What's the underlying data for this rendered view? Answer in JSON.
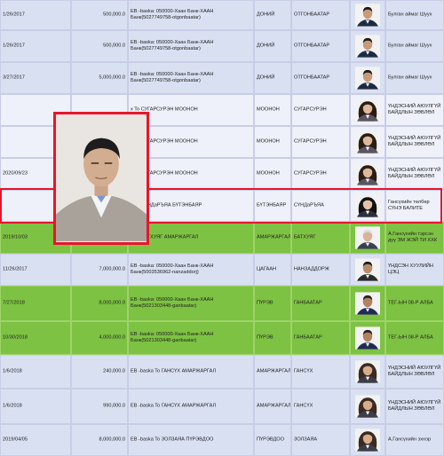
{
  "rows": [
    {
      "date": "1/26/2017",
      "amount": "500,000.0",
      "desc": "EB -baska: 050000-Хаан Банк-ХААН Банк(5027749758-otgonbaatar)",
      "surname": "ДОНИЙ",
      "name": "ОТГОНБААТАР",
      "position": "Булган аймаг Шуух",
      "style": "blue",
      "photo": "man"
    },
    {
      "date": "1/26/2017",
      "amount": "500,000.0",
      "desc": "EB -baska: 050000-Хаан Банк-ХААН Банк(5027749758-otgonbaatar)",
      "surname": "ДОНИЙ",
      "name": "ОТГОНБААТАР",
      "position": "Булган аймаг Шуух",
      "style": "blue",
      "photo": "man"
    },
    {
      "date": "3/27/2017",
      "amount": "5,000,000.0",
      "desc": "EB -baska: 050000-Хаан Банк-ХААН Банк(5027749758-otgonbaatar)",
      "surname": "ДОНИЙ",
      "name": "ОТГОНБААТАР",
      "position": "Булган аймаг Шуух",
      "style": "blue",
      "photo": "man"
    },
    {
      "date": "",
      "amount": "",
      "desc": "x To СУГАРСУРЭН МООНОН",
      "surname": "МООНОН",
      "name": "СУГАРСУРЭН",
      "position": "ҮНДЭСНИЙ АЮУЛГҮЙ БАЙДЛЫН ЗӨВЛӨЛ",
      "style": "white",
      "photo": "woman"
    },
    {
      "date": "",
      "amount": "",
      "desc": "x To СУГАРСУРЭН МООНОН",
      "surname": "МООНОН",
      "name": "СУГАРСУРЭН",
      "position": "ҮНДЭСНИЙ АЮУЛГҮЙ БАЙДЛЫН ЗӨВЛӨЛ",
      "style": "white",
      "photo": "woman"
    },
    {
      "date": "2020/09/23",
      "amount": "",
      "desc": "x To СУГАРСУРЭН МООНОН",
      "surname": "МООНОН",
      "name": "СУГАРСУРЭН",
      "position": "ҮНДЭСНИЙ АЮУЛГҮЙ БАЙДЛЫН ЗӨВЛӨЛ",
      "style": "white",
      "photo": "woman"
    },
    {
      "date": "",
      "amount": "",
      "desc": "x To СҮНДаРЪЯА БҮТЭНБАЯР",
      "surname": "БҮТЭНБАЯР",
      "name": "СҮНДаРЪЯА",
      "position": "Гансүхийн төлбөр СҮНЭ БАЛИТЕ",
      "style": "white",
      "photo": "woman2"
    },
    {
      "date": "2019/10/03",
      "amount": "",
      "desc": "x To БАТХУЯГ АМАРЖАРГАЛ",
      "surname": "АМАРЖАРГАЛ",
      "name": "БАТХУЯГ",
      "position": "А.Гансүхийн тэрсэн дүү ЭМ ЖЭЙ ТИ ХХК",
      "style": "green",
      "photo": "older"
    },
    {
      "date": "11/26/2017",
      "amount": "7,000,000.0",
      "desc": "EB -baska: 050000-Хаан Банк-ХААН Банк(5003536962-nanzaddorj)",
      "surname": "ЦАГААН",
      "name": "НАНЗАДДОРЖ",
      "position": "ҮНДСЭН ХУУЛИЙН ЦЭЦ",
      "style": "blue",
      "photo": "man2"
    },
    {
      "date": "7/27/2018",
      "amount": "8,000,000.0",
      "desc": "EB -baska: 050000-Хаан Банк-ХААН Банк(5021303448-ganbaatar)",
      "surname": "ПҮРЭВ",
      "name": "ГАНБААТАР",
      "position": "ТЕГ-ЫН 08-Р АЛБА",
      "style": "green",
      "photo": "man3"
    },
    {
      "date": "10/30/2018",
      "amount": "4,000,000.0",
      "desc": "EB -baska: 050000-Хаан Банк-ХААН Банк(5021303448-ganbaatar)",
      "surname": "ПҮРЭВ",
      "name": "ГАНБААТАР",
      "position": "ТЕГ-ЫН 08-Р АЛБА",
      "style": "green",
      "photo": "man3"
    },
    {
      "date": "1/6/2018",
      "amount": "240,000.0",
      "desc": "EB -baska To ГАНСҮХ АМАРЖАРГАЛ",
      "surname": "АМАРЖАРГАЛ",
      "name": "ГАНСҮХ",
      "position": "ҮНДЭСНИЙ АЮУЛГҮЙ БАЙДЛЫН ЗӨВЛӨЛ",
      "style": "blue",
      "photo": "woman3"
    },
    {
      "date": "1/6/2018",
      "amount": "990,000.0",
      "desc": "EB -baska To ГАНСҮХ АМАРЖАРГАЛ",
      "surname": "АМАРЖАРГАЛ",
      "name": "ГАНСҮХ",
      "position": "ҮНДЭСНИЙ АЮУЛГҮЙ БАЙДЛЫН ЗӨВЛӨЛ",
      "style": "blue",
      "photo": "woman3"
    },
    {
      "date": "2019/04/05",
      "amount": "8,000,000.0",
      "desc": "EB -baska To ЗОЛЗАЯА ПҮРЭВДОО",
      "surname": "ПҮРЭВДОО",
      "name": "ЗОЛЗАЯА",
      "position": "А.Гансүхийн эхнэр",
      "style": "blue",
      "photo": "woman3"
    }
  ],
  "highlighted_row_index": 6,
  "popup": {
    "subject": "enlarged-portrait-man-grey-jacket"
  },
  "colors": {
    "blue_row": "#d9e0f2",
    "white_row": "#eef0fa",
    "green_row": "#7dc242",
    "highlight": "#e8152b",
    "grid": "#c9cde6"
  }
}
